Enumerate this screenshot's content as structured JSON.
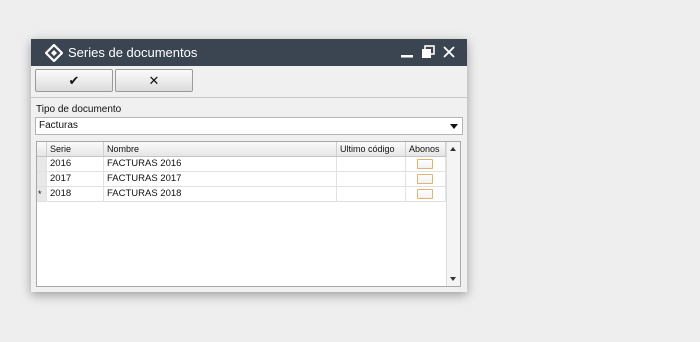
{
  "window": {
    "title": "Series de documentos",
    "titlebar_color": "#3b4552",
    "icons": {
      "app": "diamond-app-icon",
      "minimize": "minimize-icon",
      "maximize": "restore-icon",
      "close": "close-icon"
    }
  },
  "toolbar": {
    "ok_label": "✔",
    "cancel_label": "✕"
  },
  "filter": {
    "label": "Tipo de documento",
    "value": "Facturas"
  },
  "grid": {
    "columns": {
      "serie": "Serie",
      "nombre": "Nombre",
      "ultimo": "Ultimo código",
      "abonos": "Abonos"
    },
    "rows": [
      {
        "indicator": "",
        "serie": "2016",
        "nombre": "FACTURAS 2016",
        "ultimo": "",
        "abonos": false
      },
      {
        "indicator": "",
        "serie": "2017",
        "nombre": "FACTURAS 2017",
        "ultimo": "",
        "abonos": false
      },
      {
        "indicator": "*",
        "serie": "2018",
        "nombre": "FACTURAS 2018",
        "ultimo": "",
        "abonos": false
      }
    ]
  }
}
